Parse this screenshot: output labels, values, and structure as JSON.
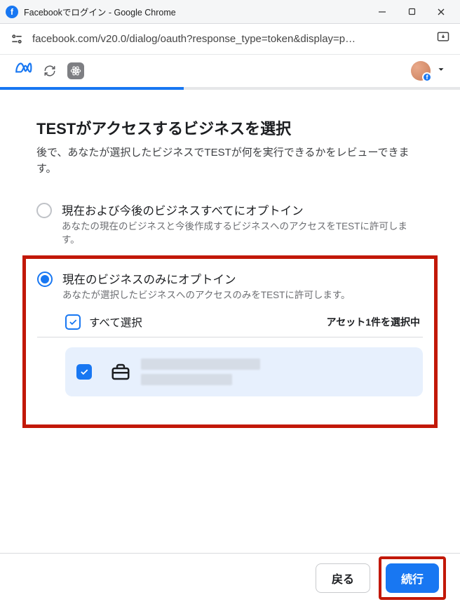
{
  "window": {
    "title": "Facebookでログイン - Google Chrome"
  },
  "url": {
    "display": "facebook.com/v20.0/dialog/oauth?response_type=token&display=p…"
  },
  "progress": {
    "percent": 40
  },
  "page": {
    "title": "TESTがアクセスするビジネスを選択",
    "subtitle": "後で、あなたが選択したビジネスでTESTが何を実行できるかをレビューできます。"
  },
  "options": [
    {
      "title": "現在および今後のビジネスすべてにオプトイン",
      "desc": "あなたの現在のビジネスと今後作成するビジネスへのアクセスをTESTに許可します。",
      "selected": false
    },
    {
      "title": "現在のビジネスのみにオプトイン",
      "desc": "あなたが選択したビジネスへのアクセスのみをTESTに許可します。",
      "selected": true
    }
  ],
  "select_all": {
    "label": "すべて選択",
    "count_label": "アセット1件を選択中"
  },
  "footer": {
    "back": "戻る",
    "continue": "続行"
  }
}
